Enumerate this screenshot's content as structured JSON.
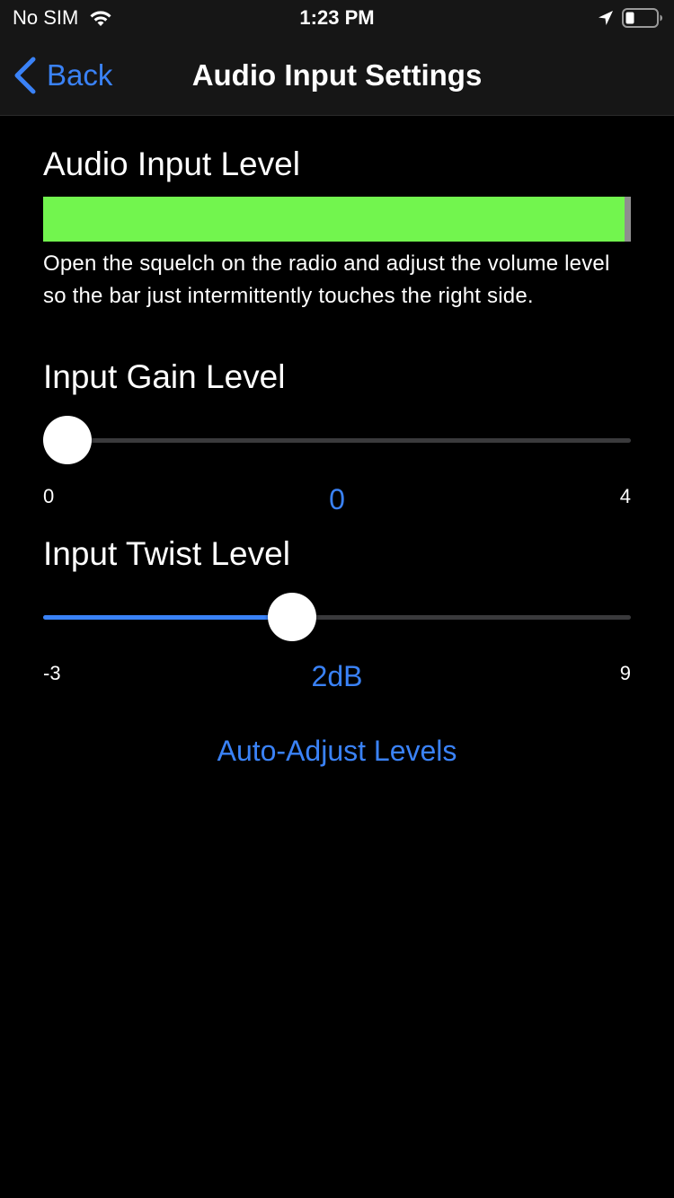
{
  "status_bar": {
    "carrier": "No SIM",
    "time": "1:23 PM",
    "icons": [
      "wifi-icon",
      "location-icon",
      "battery-icon"
    ]
  },
  "nav": {
    "back_label": "Back",
    "title": "Audio Input Settings",
    "back_icon": "chevron-left-icon"
  },
  "audio_input": {
    "heading": "Audio Input Level",
    "level_fraction": 0.99,
    "instructions": "Open the squelch on the radio and adjust the volume level so the bar just intermittently touches the right side."
  },
  "gain": {
    "heading": "Input Gain Level",
    "min_label": "0",
    "max_label": "4",
    "min": 0,
    "max": 4,
    "value": 0,
    "value_label": "0"
  },
  "twist": {
    "heading": "Input Twist Level",
    "min_label": "-3",
    "max_label": "9",
    "min": -3,
    "max": 9,
    "value": 2,
    "value_label": "2dB"
  },
  "auto_adjust_label": "Auto-Adjust Levels",
  "colors": {
    "accent": "#3a82f7",
    "meter": "#72f54e",
    "background": "#000000",
    "bar_background": "#161616"
  }
}
